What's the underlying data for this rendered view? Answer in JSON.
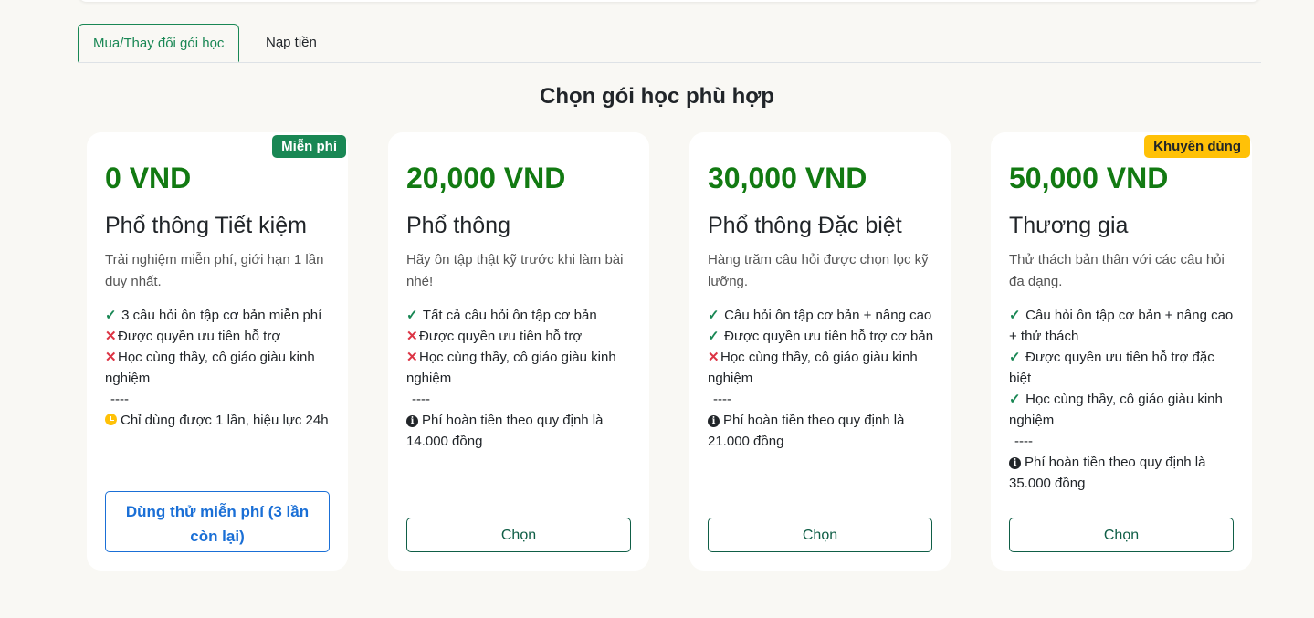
{
  "tabs": [
    "Mua/Thay đổi gói học",
    "Nạp tiền"
  ],
  "heading": "Chọn gói học phù hợp",
  "plans": [
    {
      "badge": "Miễn phí",
      "price": "0 VND",
      "title": "Phổ thông Tiết kiệm",
      "desc": "Trải nghiệm miễn phí, giới hạn 1 lần duy nhất.",
      "features": [
        {
          "icon": "check-icon",
          "text": "3 câu hỏi ôn tập cơ bản miễn phí"
        },
        {
          "icon": "cross-icon",
          "text": "Được quyền ưu tiên hỗ trợ"
        },
        {
          "icon": "cross-icon",
          "text": "Học cùng thầy, cô giáo giàu kinh nghiệm"
        },
        {
          "icon": "none",
          "text": "----"
        },
        {
          "icon": "clock-icon",
          "text": "Chỉ dùng được 1 lần, hiệu lực 24h"
        }
      ],
      "button": "Dùng thử miễn phí (3 lần còn lại)"
    },
    {
      "price": "20,000 VND",
      "title": "Phổ thông",
      "desc": "Hãy ôn tập thật kỹ trước khi làm bài nhé!",
      "features": [
        {
          "icon": "check-icon",
          "text": "Tất cả câu hỏi ôn tập cơ bản"
        },
        {
          "icon": "cross-icon",
          "text": "Được quyền ưu tiên hỗ trợ"
        },
        {
          "icon": "cross-icon",
          "text": "Học cùng thầy, cô giáo giàu kinh nghiệm"
        },
        {
          "icon": "none",
          "text": "----"
        },
        {
          "icon": "info-icon",
          "text": "Phí hoàn tiền theo quy định là 14.000 đồng"
        }
      ],
      "button": "Chọn"
    },
    {
      "price": "30,000 VND",
      "title": "Phổ thông Đặc biệt",
      "desc": "Hàng trăm câu hỏi được chọn lọc kỹ lưỡng.",
      "features": [
        {
          "icon": "check-icon",
          "text": "Câu hỏi ôn tập cơ bản + nâng cao"
        },
        {
          "icon": "check-icon",
          "text": "Được quyền ưu tiên hỗ trợ cơ bản"
        },
        {
          "icon": "cross-icon",
          "text": "Học cùng thầy, cô giáo giàu kinh nghiệm"
        },
        {
          "icon": "none",
          "text": "----"
        },
        {
          "icon": "info-icon",
          "text": "Phí hoàn tiền theo quy định là 21.000 đồng"
        }
      ],
      "button": "Chọn"
    },
    {
      "badge": "Khuyên dùng",
      "price": "50,000 VND",
      "title": "Thương gia",
      "desc": "Thử thách bản thân với các câu hỏi đa dạng.",
      "features": [
        {
          "icon": "check-icon",
          "text": "Câu hỏi ôn tập cơ bản + nâng cao + thử thách"
        },
        {
          "icon": "check-icon",
          "text": "Được quyền ưu tiên hỗ trợ đặc biệt"
        },
        {
          "icon": "check-icon",
          "text": "Học cùng thầy, cô giáo giàu kinh nghiệm"
        },
        {
          "icon": "none",
          "text": "----"
        },
        {
          "icon": "info-icon",
          "text": "Phí hoàn tiền theo quy định là 35.000 đồng"
        }
      ],
      "button": "Chọn"
    }
  ]
}
